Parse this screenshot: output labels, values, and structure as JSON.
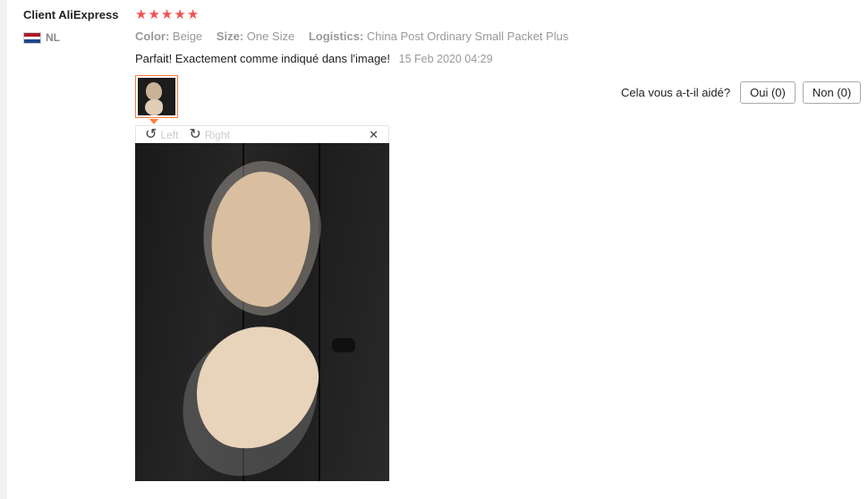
{
  "review": {
    "user": "Client AliExpress",
    "country_code": "NL",
    "rating_stars": 5,
    "stars": [
      "★",
      "★",
      "★",
      "★",
      "★"
    ],
    "attributes": [
      {
        "key": "Color:",
        "value": "Beige"
      },
      {
        "key": "Size:",
        "value": "One Size"
      },
      {
        "key": "Logistics:",
        "value": "China Post Ordinary Small Packet Plus"
      }
    ],
    "text": "Parfait! Exactement comme indiqué dans l'image!",
    "date": "15 Feb 2020 04:29"
  },
  "viewer": {
    "rotate_left_label": "Left",
    "rotate_right_label": "Right",
    "close_glyph": "✕"
  },
  "helpful": {
    "question": "Cela vous a-t-il aidé?",
    "yes_label": "Oui (0)",
    "no_label": "Non (0)"
  },
  "colors": {
    "star": "#f45151",
    "thumb_border": "#ff7a3d"
  }
}
